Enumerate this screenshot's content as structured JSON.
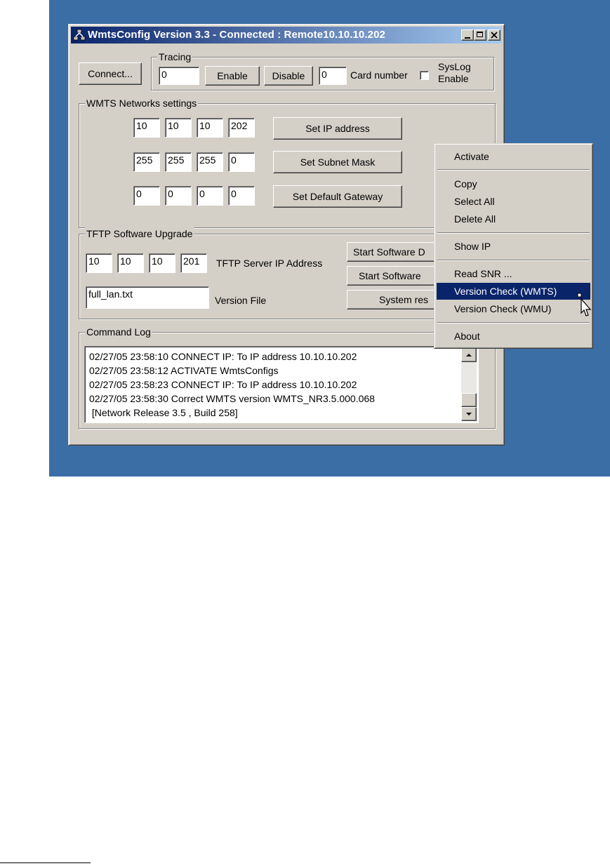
{
  "window": {
    "title": "WmtsConfig Version 3.3 - Connected : Remote10.10.10.202",
    "minimize_glyph": "_",
    "maximize_glyph": "□",
    "close_glyph": "✕"
  },
  "top": {
    "connect_label": "Connect...",
    "tracing": {
      "label": "Tracing",
      "value": "0",
      "enable_label": "Enable",
      "disable_label": "Disable",
      "card_value": "0",
      "card_label": "Card number",
      "syslog_line1": "SysLog",
      "syslog_line2": "Enable",
      "syslog_checked": false
    }
  },
  "network": {
    "label": "WMTS Networks settings",
    "ip": [
      "10",
      "10",
      "10",
      "202"
    ],
    "mask": [
      "255",
      "255",
      "255",
      "0"
    ],
    "gateway": [
      "0",
      "0",
      "0",
      "0"
    ],
    "set_ip_label": "Set IP address",
    "set_mask_label": "Set Subnet Mask",
    "set_gateway_label": "Set Default Gateway"
  },
  "tftp": {
    "label": "TFTP Software Upgrade",
    "server_ip": [
      "10",
      "10",
      "10",
      "201"
    ],
    "server_ip_label": "TFTP Server IP Address",
    "version_file": "full_lan.txt",
    "version_file_label": "Version File",
    "start_download_label": "Start Software D",
    "start_software_label": "Start Software",
    "system_reset_label": "System res"
  },
  "log": {
    "label": "Command Log",
    "lines": [
      "02/27/05 23:58:10 CONNECT IP: To IP address 10.10.10.202",
      "02/27/05 23:58:12 ACTIVATE WmtsConfigs",
      "02/27/05 23:58:23 CONNECT IP: To IP address 10.10.10.202",
      "02/27/05 23:58:30 Correct WMTS version WMTS_NR3.5.000.068",
      " [Network Release 3.5 , Build 258]"
    ]
  },
  "context_menu": {
    "items": [
      {
        "label": "Activate"
      },
      {
        "label": "Copy"
      },
      {
        "label": "Select All"
      },
      {
        "label": "Delete All"
      },
      {
        "label": "Show IP"
      },
      {
        "label": "Read SNR ..."
      },
      {
        "label": "Version Check (WMTS)",
        "selected": true
      },
      {
        "label": "Version Check (WMU)"
      },
      {
        "label": "About"
      }
    ]
  },
  "colors": {
    "desktop": "#3a6ea5",
    "face": "#d4d0c8",
    "title_start": "#0a246a",
    "title_end": "#a6caf0",
    "highlight": "#0a246a"
  }
}
